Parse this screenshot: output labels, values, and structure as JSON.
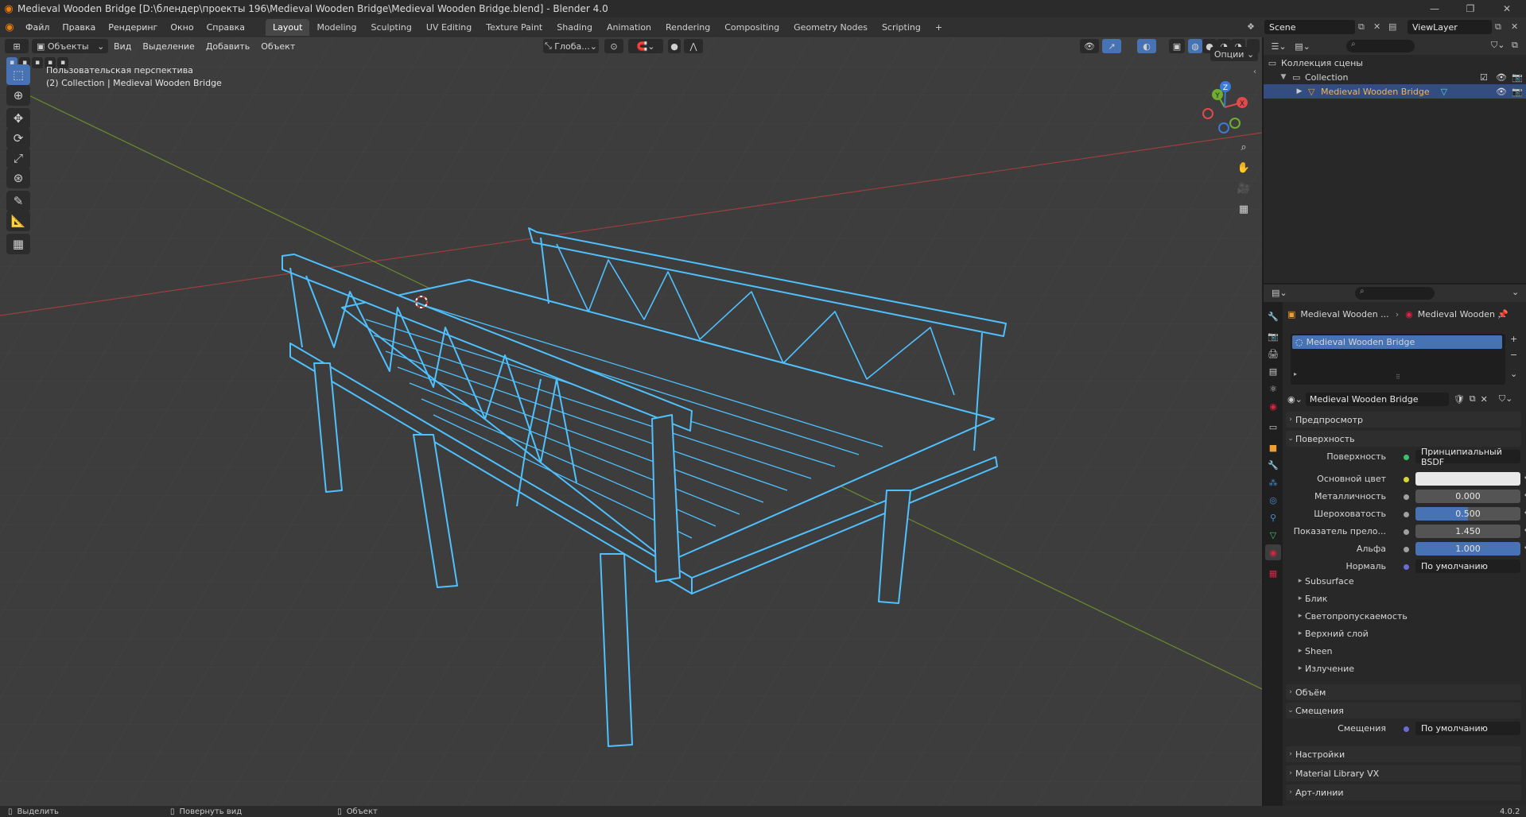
{
  "window": {
    "title": "Medieval Wooden Bridge [D:\\блендер\\проекты 196\\Medieval Wooden Bridge\\Medieval Wooden Bridge.blend] - Blender 4.0",
    "minimize": "—",
    "maximize": "❐",
    "close": "✕"
  },
  "menu": {
    "items": [
      "Файл",
      "Правка",
      "Рендеринг",
      "Окно",
      "Справка"
    ],
    "workspaces": [
      "Layout",
      "Modeling",
      "Sculpting",
      "UV Editing",
      "Texture Paint",
      "Shading",
      "Animation",
      "Rendering",
      "Compositing",
      "Geometry Nodes",
      "Scripting"
    ],
    "add_tab": "+",
    "active_workspace": "Layout",
    "scene": "Scene",
    "view_layer": "ViewLayer"
  },
  "viewport": {
    "mode": "Объекты",
    "header_menus": [
      "Вид",
      "Выделение",
      "Добавить",
      "Объект"
    ],
    "orientation": "Глоба...",
    "options": "Опции",
    "info_line1": "Пользовательская перспектива",
    "info_line2": "(2) Collection | Medieval Wooden Bridge",
    "gizmo": {
      "x": "X",
      "y": "Y",
      "z": "Z"
    }
  },
  "outliner": {
    "root": "Коллекция сцены",
    "collection": "Collection",
    "object": "Medieval Wooden Bridge"
  },
  "properties": {
    "breadcrumb_object": "Medieval Wooden ...",
    "breadcrumb_material": "Medieval Wooden ...",
    "slot_name": "Medieval Wooden Bridge",
    "material_name": "Medieval Wooden Bridge",
    "sections": {
      "preview": "Предпросмотр",
      "surface": "Поверхность",
      "volume": "Объём",
      "displacement": "Смещения",
      "settings": "Настройки",
      "material_library": "Material Library VX",
      "lineart": "Арт-линии"
    },
    "surface_label": "Поверхность",
    "surface_value": "Принципиальный BSDF",
    "fields": [
      {
        "label": "Основной цвет",
        "value": ""
      },
      {
        "label": "Металличность",
        "value": "0.000"
      },
      {
        "label": "Шероховатость",
        "value": "0.500"
      },
      {
        "label": "Показатель прело...",
        "value": "1.450"
      },
      {
        "label": "Альфа",
        "value": "1.000"
      },
      {
        "label": "Нормаль",
        "value": "По умолчанию"
      }
    ],
    "subpanels": [
      "Subsurface",
      "Блик",
      "Светопропускаемость",
      "Верхний слой",
      "Sheen",
      "Излучение"
    ],
    "displacement_label": "Смещения",
    "displacement_value": "По умолчанию",
    "colors": {
      "accent": "#4772b3",
      "base_color": "#e8e8e8"
    }
  },
  "statusbar": {
    "select": "Выделить",
    "rotate": "Повернуть вид",
    "object": "Объект",
    "version": "4.0.2"
  }
}
